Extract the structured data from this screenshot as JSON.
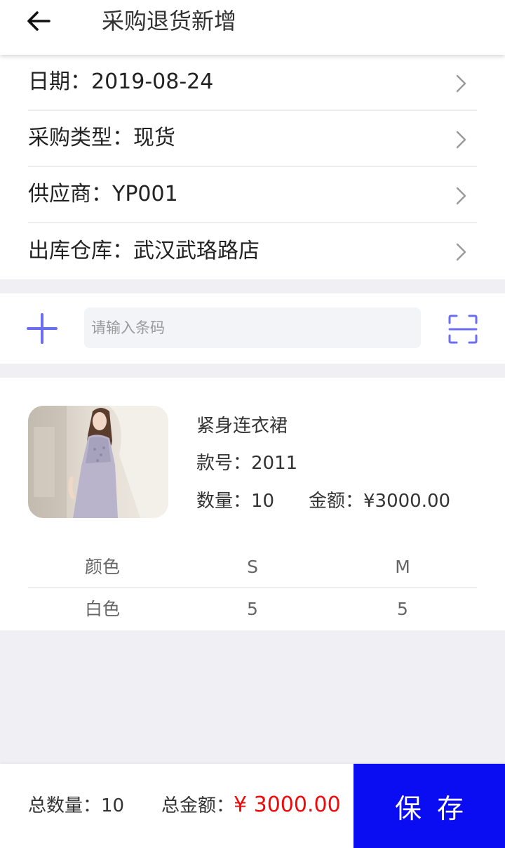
{
  "header": {
    "title": "采购退货新增"
  },
  "info": {
    "rows": [
      {
        "label": "日期：",
        "value": "2019-08-24"
      },
      {
        "label": "采购类型：",
        "value": "现货"
      },
      {
        "label": "供应商：",
        "value": "YP001"
      },
      {
        "label": "出库仓库：",
        "value": "武汉武珞路店"
      }
    ]
  },
  "barcode": {
    "placeholder": "请输入条码",
    "value": ""
  },
  "product": {
    "name": "紧身连衣裙",
    "style_no": "款号：2011",
    "quantity": "数量：10",
    "amount": "金额：¥3000.00",
    "table": {
      "headers": [
        "颜色",
        "S",
        "M"
      ],
      "rows": [
        [
          "白色",
          "5",
          "5"
        ]
      ]
    }
  },
  "footer": {
    "total_qty": "总数量：10",
    "total_amount_label": "总金额：",
    "total_amount_value": "¥ 3000.00",
    "save_label": "保存"
  },
  "colors": {
    "accent": "#6b6ef0",
    "primary_button": "#0a0cf2",
    "price_red": "#ee0a0a",
    "background": "#efeff4"
  },
  "icons": {
    "back": "arrow-left-icon",
    "chevron": "chevron-right-icon",
    "add": "plus-icon",
    "scan": "scan-icon",
    "product": "dress-photo"
  }
}
